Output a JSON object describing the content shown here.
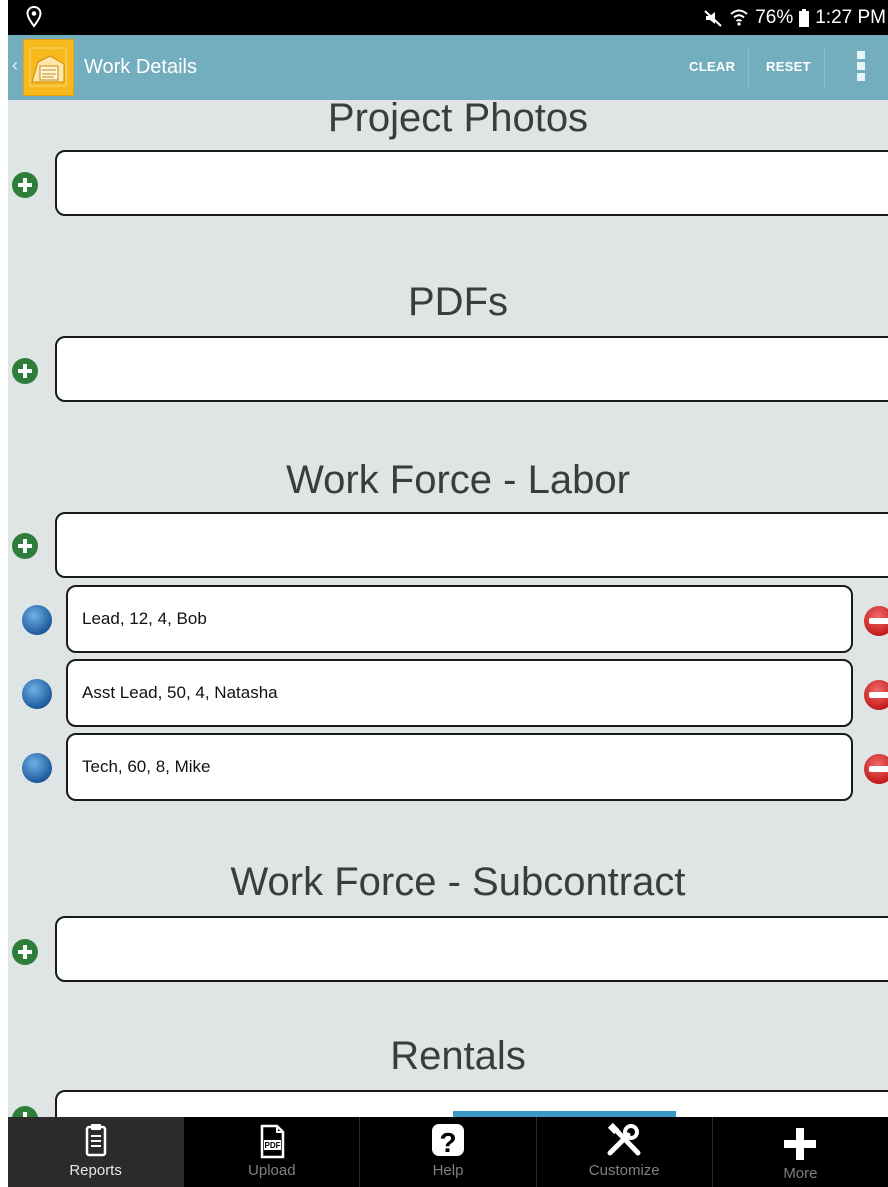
{
  "status_bar": {
    "battery": "76%",
    "time": "1:27 PM",
    "icons": [
      "location-icon",
      "mute-icon",
      "wifi-icon",
      "battery-icon"
    ]
  },
  "action_bar": {
    "back_glyph": "‹",
    "title": "Work Details",
    "clear_label": "CLEAR",
    "reset_label": "RESET",
    "menu_icon": "overflow-menu-icon",
    "background": "#72aebd"
  },
  "sections": {
    "photos": {
      "title": "Project Photos"
    },
    "pdfs": {
      "title": "PDFs"
    },
    "labor": {
      "title": "Work Force - Labor",
      "rows": [
        {
          "text": "Lead, 12, 4, Bob"
        },
        {
          "text": "Asst Lead, 50, 4, Natasha"
        },
        {
          "text": "Tech, 60, 8, Mike"
        }
      ]
    },
    "subcontract": {
      "title": "Work Force - Subcontract"
    },
    "rentals": {
      "title": "Rentals"
    }
  },
  "bottom_nav": {
    "tabs": [
      {
        "label": "Reports",
        "icon": "clipboard-icon",
        "active": true
      },
      {
        "label": "Upload",
        "icon": "pdf-icon",
        "active": false
      },
      {
        "label": "Help",
        "icon": "help-icon",
        "active": false
      },
      {
        "label": "Customize",
        "icon": "tools-icon",
        "active": false
      },
      {
        "label": "More",
        "icon": "plus-icon",
        "active": false
      }
    ]
  },
  "colors": {
    "content_bg": "#dfe4e4",
    "add_green": "#2f7d3a",
    "edit_blue": "#1f5a9e",
    "remove_red": "#c51f1f",
    "scroll_indicator": "#3a9ac4"
  }
}
